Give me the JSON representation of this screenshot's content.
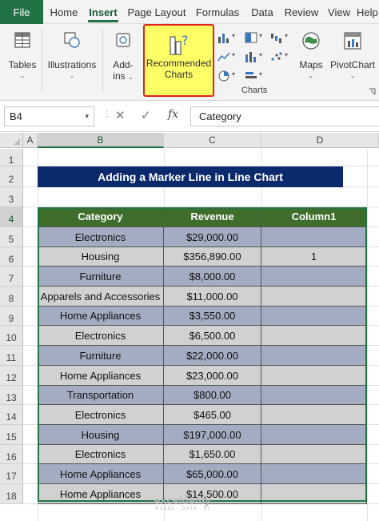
{
  "ribbon": {
    "tabs": [
      "File",
      "Home",
      "Insert",
      "Page Layout",
      "Formulas",
      "Data",
      "Review",
      "View",
      "Help"
    ],
    "active_tab": "Insert",
    "tables_label": "Tables",
    "illustrations_label": "Illustrations",
    "addins_label_1": "Add-",
    "addins_label_2": "ins",
    "recommended_label_1": "Recommended",
    "recommended_label_2": "Charts",
    "charts_group_label": "Charts",
    "maps_label": "Maps",
    "pivotchart_label": "PivotChart"
  },
  "formula_bar": {
    "name_box": "B4",
    "cancel_symbol": "✕",
    "enter_symbol": "✓",
    "fx_label": "fx",
    "content": "Category"
  },
  "sheet": {
    "columns": [
      "A",
      "B",
      "C",
      "D"
    ],
    "rows": [
      "1",
      "2",
      "3",
      "4",
      "5",
      "6",
      "7",
      "8",
      "9",
      "10",
      "11",
      "12",
      "13",
      "14",
      "15",
      "16",
      "17",
      "18"
    ],
    "title": "Adding a Marker Line in Line Chart",
    "table_headers": [
      "Category",
      "Revenue",
      "Column1"
    ],
    "table_rows": [
      [
        "Electronics",
        "$29,000.00",
        ""
      ],
      [
        "Housing",
        "$356,890.00",
        "1"
      ],
      [
        "Furniture",
        "$8,000.00",
        ""
      ],
      [
        "Apparels and Accessories",
        "$11,000.00",
        ""
      ],
      [
        "Home Appliances",
        "$3,550.00",
        ""
      ],
      [
        "Electronics",
        "$6,500.00",
        ""
      ],
      [
        "Furniture",
        "$22,000.00",
        ""
      ],
      [
        "Home Appliances",
        "$23,000.00",
        ""
      ],
      [
        "Transportation",
        "$800.00",
        ""
      ],
      [
        "Electronics",
        "$465.00",
        ""
      ],
      [
        "Housing",
        "$197,000.00",
        ""
      ],
      [
        "Electronics",
        "$1,650.00",
        ""
      ],
      [
        "Home Appliances",
        "$65,000.00",
        ""
      ],
      [
        "Home Appliances",
        "$14,500.00",
        ""
      ]
    ],
    "watermark": "exceldemy",
    "watermark_sub": "EXCEL · DATA · BI"
  },
  "colors": {
    "file_tab": "#217346",
    "title_bar": "#0b2a6b",
    "table_header": "#3f6e2c",
    "row_blue": "#a3acc0",
    "row_gray": "#d1d1d1",
    "highlight": "#ffff66",
    "highlight_border": "#e0231b"
  }
}
